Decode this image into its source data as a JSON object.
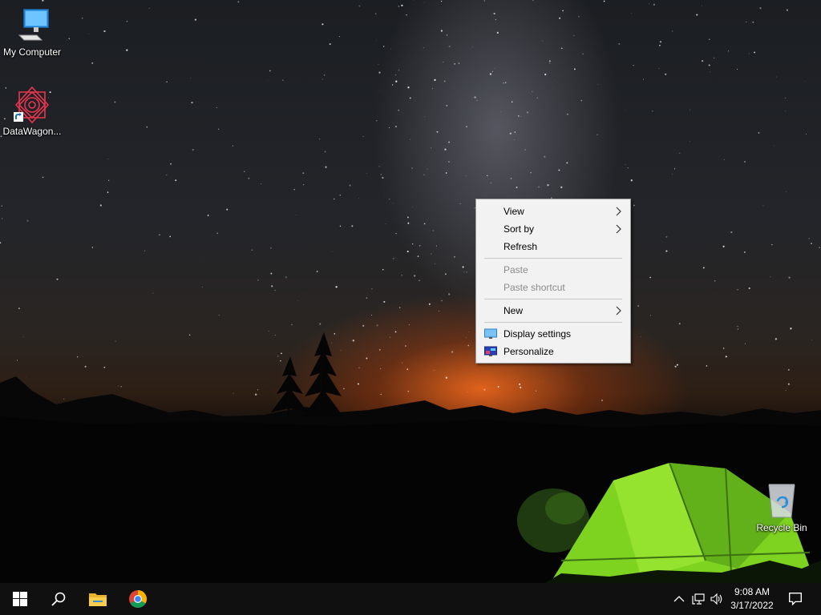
{
  "desktop": {
    "icons": [
      {
        "label": "My Computer",
        "icon": "computer-icon"
      },
      {
        "label": "DataWagon...",
        "icon": "datawagon-shortcut-icon"
      },
      {
        "label": "Recycle Bin",
        "icon": "recycle-bin-icon"
      }
    ]
  },
  "context_menu": {
    "items": [
      {
        "label": "View",
        "submenu": true
      },
      {
        "label": "Sort by",
        "submenu": true
      },
      {
        "label": "Refresh"
      },
      {
        "label": "Paste",
        "disabled": true
      },
      {
        "label": "Paste shortcut",
        "disabled": true
      },
      {
        "label": "New",
        "submenu": true
      },
      {
        "label": "Display settings",
        "icon": "display-icon"
      },
      {
        "label": "Personalize",
        "icon": "personalize-icon"
      }
    ]
  },
  "taskbar": {
    "buttons": [
      "start-icon",
      "search-icon",
      "file-explorer-icon",
      "chrome-icon"
    ],
    "tray": [
      "chevron-up-icon",
      "network-icon",
      "volume-icon",
      "notification-icon"
    ],
    "clock": {
      "time": "9:08 AM",
      "date": "3/17/2022"
    }
  },
  "colors": {
    "taskbar": "#101010",
    "menu_bg": "#f2f2f2",
    "tent": "#7ed321",
    "windows_blue": "#0078d7"
  }
}
